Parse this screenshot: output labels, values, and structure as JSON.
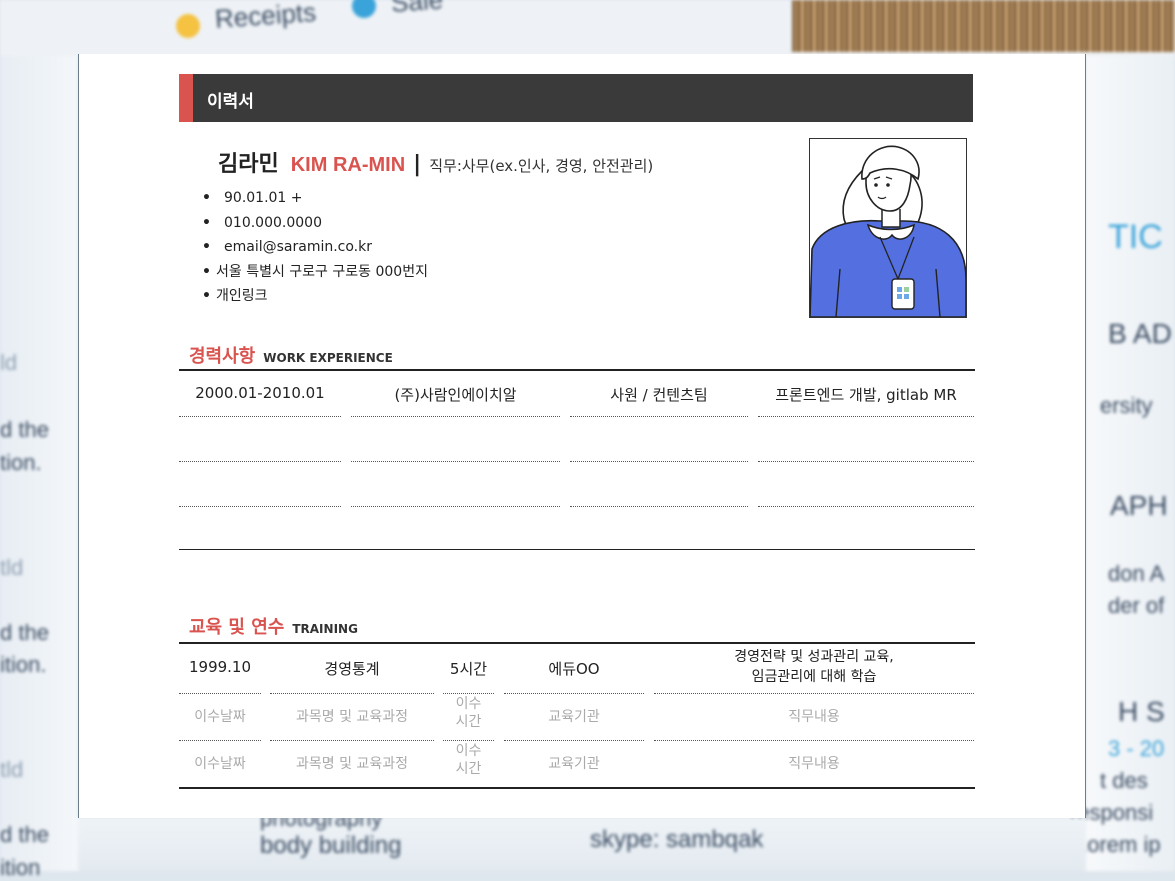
{
  "background": {
    "top_labels": [
      "Receipts",
      "Sale"
    ],
    "left_fragments": [
      "ld",
      "d the",
      "tion.",
      "tld",
      "d the",
      "ition.",
      "tld",
      "d the",
      "ition"
    ],
    "right_fragments": [
      "TIC",
      "B AD",
      "ersity",
      "APH",
      "don A",
      "der of",
      "H S",
      "3 - 20",
      "t des",
      "responsi",
      "Lorem ip"
    ],
    "bottom_fragments": [
      "photography",
      "body building",
      "skype: sambqak"
    ]
  },
  "resume": {
    "header_title": "이력서",
    "name_ko": "김라민",
    "name_en": "KIM RA-MIN",
    "name_sep": "|",
    "job": "직무:사무(ex.인사, 경영, 안전관리)",
    "info": [
      {
        "bullet": "•",
        "text": "90.01.01 +"
      },
      {
        "bullet": "•",
        "text": "010.000.0000"
      },
      {
        "bullet": "•",
        "text": "email@saramin.co.kr"
      },
      {
        "bullet": "•",
        "text": "서울 특별시 구로구 구로동 000번지"
      },
      {
        "bullet": "•",
        "text": "개인링크"
      }
    ],
    "photo_icon": "person-illustration-icon"
  },
  "work": {
    "title_ko": "경력사항",
    "title_en": "WORK EXPERIENCE",
    "rows": [
      {
        "period": "2000.01-2010.01",
        "company": "(주)사람인에이치알",
        "position": "사원 / 컨텐츠팀",
        "duty": "프론트엔드 개발, gitlab MR"
      }
    ]
  },
  "training": {
    "title_ko": "교육 및 연수",
    "title_en": "TRAINING",
    "rows": [
      {
        "date": "1999.10",
        "course": "경영통계",
        "hours": "5시간",
        "org": "에듀OO",
        "content": "경영전략 및 성과관리 교육,\n임금관리에 대해 학습"
      },
      {
        "date": "이수날짜",
        "course": "과목명 및 교육과정",
        "hours": "이수\n시간",
        "org": "교육기관",
        "content": "직무내용"
      },
      {
        "date": "이수날짜",
        "course": "과목명 및 교육과정",
        "hours": "이수\n시간",
        "org": "교육기관",
        "content": "직무내용"
      }
    ]
  }
}
